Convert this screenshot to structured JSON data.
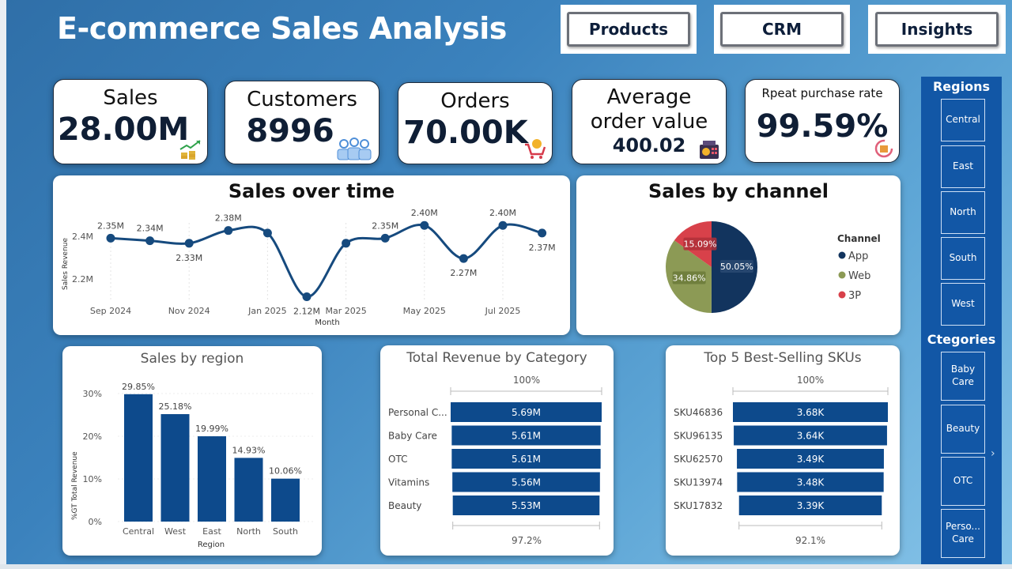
{
  "header": {
    "title": "E-commerce Sales Analysis"
  },
  "nav": {
    "products": "Products",
    "crm": "CRM",
    "insights": "Insights"
  },
  "kpis": {
    "sales": {
      "label": "Sales",
      "value": "28.00M",
      "icon": "money-growth-icon"
    },
    "customers": {
      "label": "Customers",
      "value": "8996",
      "icon": "people-group-icon"
    },
    "orders": {
      "label": "Orders",
      "value": "70.00K",
      "icon": "shopping-cart-icon"
    },
    "aov": {
      "label_line1": "Average",
      "label_line2": "order value",
      "value": "400.02",
      "icon": "cash-register-icon"
    },
    "repeat": {
      "label": "Rpeat purchase rate",
      "value": "99.59%",
      "icon": "repeat-box-icon"
    }
  },
  "sales_over_time": {
    "title": "Sales over time",
    "ylabel": "Sales Revenue",
    "xlabel": "Month",
    "yticks": [
      "2.4M",
      "2.2M"
    ],
    "xticks": [
      "Sep 2024",
      "Nov 2024",
      "Jan 2025",
      "Mar 2025",
      "May 2025",
      "Jul 2025"
    ]
  },
  "sales_by_channel": {
    "title": "Sales by channel",
    "legend_title": "Channel"
  },
  "sales_by_region": {
    "title": "Sales by region",
    "ylabel": "%GT Total Revenue",
    "xlabel": "Region",
    "yticks": [
      "30%",
      "20%",
      "10%",
      "0%"
    ]
  },
  "revenue_by_category": {
    "title": "Total Revenue by Category",
    "top_label": "100%",
    "bottom_label": "97.2%"
  },
  "top_skus": {
    "title": "Top 5 Best-Selling SKUs",
    "top_label": "100%",
    "bottom_label": "92.1%"
  },
  "sidebar": {
    "regions_title": "Regions",
    "regions": [
      "Central",
      "East",
      "North",
      "South",
      "West"
    ],
    "categories_title": "Ctegories",
    "categories": [
      "Baby Care",
      "Beauty",
      "OTC",
      "Perso... Care"
    ]
  },
  "colors": {
    "navy": "#0f3a6b",
    "bar": "#0d4a8c",
    "app": "#12345e",
    "web": "#8c9a55",
    "p3": "#d8414a",
    "line": "#164a7e"
  },
  "chart_data": [
    {
      "type": "line",
      "title": "Sales over time",
      "xlabel": "Month",
      "ylabel": "Sales Revenue",
      "x": [
        "Sep 2024",
        "Oct 2024",
        "Nov 2024",
        "Dec 2024",
        "Jan 2025",
        "Feb 2025",
        "Mar 2025",
        "Apr 2025",
        "May 2025",
        "Jun 2025",
        "Jul 2025",
        "Aug 2025"
      ],
      "values": [
        2.35,
        2.34,
        2.33,
        2.38,
        2.37,
        2.12,
        2.33,
        2.35,
        2.4,
        2.27,
        2.4,
        2.37
      ],
      "labels": [
        "2.35M",
        "2.34M",
        "2.33M",
        "2.38M",
        "",
        "2.12M",
        "",
        "2.35M",
        "2.40M",
        "2.27M",
        "2.40M",
        "2.37M"
      ],
      "ylim": [
        2.1,
        2.45
      ],
      "grid": false
    },
    {
      "type": "pie",
      "title": "Sales by channel",
      "categories": [
        "App",
        "Web",
        "3P"
      ],
      "values": [
        50.05,
        34.86,
        15.09
      ],
      "labels": [
        "50.05%",
        "34.86%",
        "15.09%"
      ],
      "legend": "right"
    },
    {
      "type": "bar",
      "title": "Sales by region",
      "categories": [
        "Central",
        "West",
        "East",
        "North",
        "South"
      ],
      "values": [
        29.85,
        25.18,
        19.99,
        14.93,
        10.06
      ],
      "labels": [
        "29.85%",
        "25.18%",
        "19.99%",
        "14.93%",
        "10.06%"
      ],
      "xlabel": "Region",
      "ylabel": "%GT Total Revenue",
      "ylim": [
        0,
        32
      ]
    },
    {
      "type": "bar",
      "orientation": "horizontal-funnel",
      "title": "Total Revenue by Category",
      "categories": [
        "Personal C...",
        "Baby Care",
        "OTC",
        "Vitamins",
        "Beauty"
      ],
      "values": [
        5.69,
        5.61,
        5.61,
        5.56,
        5.53
      ],
      "labels": [
        "5.69M",
        "5.61M",
        "5.61M",
        "5.56M",
        "5.53M"
      ]
    },
    {
      "type": "bar",
      "orientation": "horizontal-funnel",
      "title": "Top 5 Best-Selling SKUs",
      "categories": [
        "SKU46836",
        "SKU96135",
        "SKU62570",
        "SKU13974",
        "SKU17832"
      ],
      "values": [
        3.68,
        3.64,
        3.49,
        3.48,
        3.39
      ],
      "labels": [
        "3.68K",
        "3.64K",
        "3.49K",
        "3.48K",
        "3.39K"
      ]
    }
  ]
}
